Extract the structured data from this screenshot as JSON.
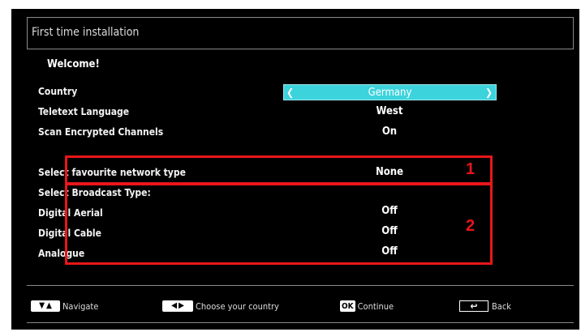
{
  "window": {
    "title": "First time installation"
  },
  "welcome": "Welcome!",
  "settings": {
    "country": {
      "label": "Country",
      "value": "Germany"
    },
    "teletext": {
      "label": "Teletext Language",
      "value": "West"
    },
    "encrypted": {
      "label": "Scan Encrypted Channels",
      "value": "On"
    },
    "network": {
      "label": "Select favourite network type",
      "value": "None"
    },
    "broadcast_heading": "Select Broadcast Type:",
    "aerial": {
      "label": "Digital Aerial",
      "value": "Off"
    },
    "cable": {
      "label": "Digital Cable",
      "value": "Off"
    },
    "analogue": {
      "label": "Analogue",
      "value": "Off"
    }
  },
  "annotations": {
    "box1": "1",
    "box2": "2"
  },
  "footer": {
    "navigate": "Navigate",
    "choose": "Choose your country",
    "ok_key": "OK",
    "continue": "Continue",
    "back": "Back"
  },
  "colors": {
    "highlight": "#3dd3dc",
    "annotation": "#e8161a",
    "background": "#000000"
  }
}
